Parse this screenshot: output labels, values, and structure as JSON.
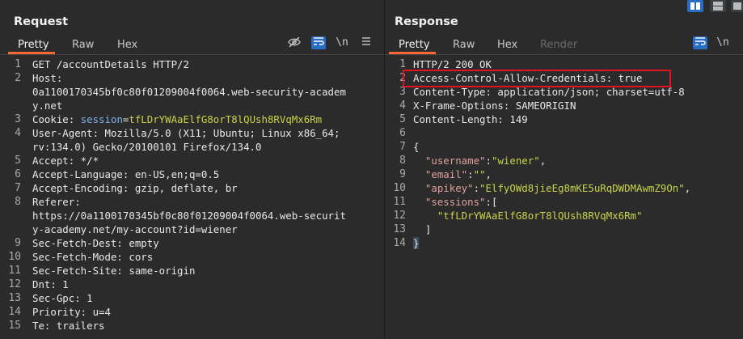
{
  "request": {
    "title": "Request",
    "tabs": [
      "Pretty",
      "Raw",
      "Hex"
    ],
    "active_tab": "Pretty",
    "toolbar": {
      "hide_icon": "eye-off-icon",
      "wrap_icon": "wrap-icon",
      "newline": "\\n",
      "menu_icon": "menu-icon"
    },
    "lines": [
      {
        "n": "1",
        "segments": [
          {
            "t": "GET /accountDetails HTTP/2",
            "c": "key"
          }
        ]
      },
      {
        "n": "2",
        "segments": [
          {
            "t": "Host:",
            "c": "key"
          }
        ]
      },
      {
        "n": "",
        "segments": [
          {
            "t": "0a1100170345bf0c80f01209004f0064.web-security-academ",
            "c": "key"
          }
        ]
      },
      {
        "n": "",
        "segments": [
          {
            "t": "y.net",
            "c": "key"
          }
        ]
      },
      {
        "n": "3",
        "segments": [
          {
            "t": "Cookie: ",
            "c": "key"
          },
          {
            "t": "session",
            "c": "cookie-name"
          },
          {
            "t": "=",
            "c": "key"
          },
          {
            "t": "tfLDrYWAaElfG8orT8lQUsh8RVqMx6Rm",
            "c": "cookie-val"
          }
        ]
      },
      {
        "n": "4",
        "segments": [
          {
            "t": "User-Agent: Mozilla/5.0 (X11; Ubuntu; Linux x86_64;",
            "c": "key"
          }
        ]
      },
      {
        "n": "",
        "segments": [
          {
            "t": "rv:134.0) Gecko/20100101 Firefox/134.0",
            "c": "key"
          }
        ]
      },
      {
        "n": "5",
        "segments": [
          {
            "t": "Accept: */*",
            "c": "key"
          }
        ]
      },
      {
        "n": "6",
        "segments": [
          {
            "t": "Accept-Language: en-US,en;q=0.5",
            "c": "key"
          }
        ]
      },
      {
        "n": "7",
        "segments": [
          {
            "t": "Accept-Encoding: gzip, deflate, br",
            "c": "key"
          }
        ]
      },
      {
        "n": "8",
        "segments": [
          {
            "t": "Referer:",
            "c": "key"
          }
        ]
      },
      {
        "n": "",
        "segments": [
          {
            "t": "https://0a1100170345bf0c80f01209004f0064.web-securit",
            "c": "key"
          }
        ]
      },
      {
        "n": "",
        "segments": [
          {
            "t": "y-academy.net/my-account?id=wiener",
            "c": "key"
          }
        ]
      },
      {
        "n": "9",
        "segments": [
          {
            "t": "Sec-Fetch-Dest: empty",
            "c": "key"
          }
        ]
      },
      {
        "n": "10",
        "segments": [
          {
            "t": "Sec-Fetch-Mode: cors",
            "c": "key"
          }
        ]
      },
      {
        "n": "11",
        "segments": [
          {
            "t": "Sec-Fetch-Site: same-origin",
            "c": "key"
          }
        ]
      },
      {
        "n": "12",
        "segments": [
          {
            "t": "Dnt: 1",
            "c": "key"
          }
        ]
      },
      {
        "n": "13",
        "segments": [
          {
            "t": "Sec-Gpc: 1",
            "c": "key"
          }
        ]
      },
      {
        "n": "14",
        "segments": [
          {
            "t": "Priority: u=4",
            "c": "key"
          }
        ]
      },
      {
        "n": "15",
        "segments": [
          {
            "t": "Te: trailers",
            "c": "key"
          }
        ]
      }
    ]
  },
  "response": {
    "title": "Response",
    "tabs": [
      "Pretty",
      "Raw",
      "Hex",
      "Render"
    ],
    "active_tab": "Pretty",
    "toolbar": {
      "wrap_icon": "wrap-icon",
      "newline": "\\n"
    },
    "lines": [
      {
        "n": "1",
        "segments": [
          {
            "t": "HTTP/2 200 OK",
            "c": "key"
          }
        ]
      },
      {
        "n": "2",
        "segments": [
          {
            "t": "Access-Control-Allow-Credentials: true",
            "c": "key"
          }
        ]
      },
      {
        "n": "3",
        "segments": [
          {
            "t": "Content-Type: application/json; charset=utf-8",
            "c": "key"
          }
        ]
      },
      {
        "n": "4",
        "segments": [
          {
            "t": "X-Frame-Options: SAMEORIGIN",
            "c": "key"
          }
        ]
      },
      {
        "n": "5",
        "segments": [
          {
            "t": "Content-Length: 149",
            "c": "key"
          }
        ]
      },
      {
        "n": "6",
        "segments": []
      },
      {
        "n": "7",
        "segments": [
          {
            "t": "{",
            "c": "key"
          }
        ]
      },
      {
        "n": "8",
        "segments": [
          {
            "t": "  ",
            "c": "key"
          },
          {
            "t": "\"username\"",
            "c": "jkey"
          },
          {
            "t": ":",
            "c": "key"
          },
          {
            "t": "\"wiener\"",
            "c": "jstr"
          },
          {
            "t": ",",
            "c": "key"
          }
        ]
      },
      {
        "n": "9",
        "segments": [
          {
            "t": "  ",
            "c": "key"
          },
          {
            "t": "\"email\"",
            "c": "jkey"
          },
          {
            "t": ":",
            "c": "key"
          },
          {
            "t": "\"\"",
            "c": "jstr"
          },
          {
            "t": ",",
            "c": "key"
          }
        ]
      },
      {
        "n": "10",
        "segments": [
          {
            "t": "  ",
            "c": "key"
          },
          {
            "t": "\"apikey\"",
            "c": "jkey"
          },
          {
            "t": ":",
            "c": "key"
          },
          {
            "t": "\"ElfyOWd8jieEg8mKE5uRqDWDMAwmZ9On\"",
            "c": "jstr"
          },
          {
            "t": ",",
            "c": "key"
          }
        ]
      },
      {
        "n": "11",
        "segments": [
          {
            "t": "  ",
            "c": "key"
          },
          {
            "t": "\"sessions\"",
            "c": "jkey"
          },
          {
            "t": ":[",
            "c": "key"
          }
        ]
      },
      {
        "n": "12",
        "segments": [
          {
            "t": "    ",
            "c": "key"
          },
          {
            "t": "\"tfLDrYWAaElfG8orT8lQUsh8RVqMx6Rm\"",
            "c": "jstr"
          }
        ]
      },
      {
        "n": "13",
        "segments": [
          {
            "t": "  ]",
            "c": "key"
          }
        ]
      },
      {
        "n": "14",
        "segments": [
          {
            "t": "}",
            "c": "key"
          }
        ]
      }
    ]
  },
  "colors": {
    "accent": "#ff6633",
    "highlight_box": "#e0141e",
    "toolbar_blue": "#2a6dc4"
  },
  "layout_icons": [
    "split-horizontal-icon",
    "split-vertical-icon",
    "single-pane-icon"
  ]
}
